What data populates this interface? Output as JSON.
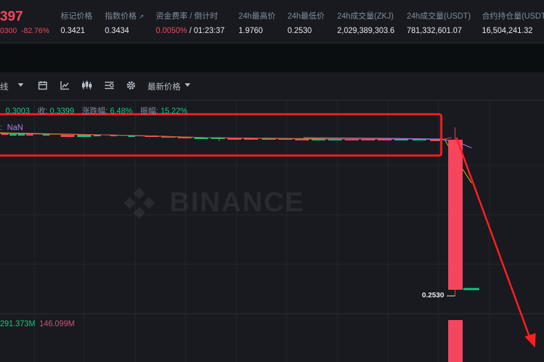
{
  "header": {
    "last_price": "397",
    "price_change": "0300",
    "price_change_pct": "-82.76%",
    "mark_price_label": "标记价格",
    "mark_price": "0.3421",
    "index_price_label": "指数价格",
    "index_price_icon": "external-link-icon",
    "index_price": "0.3434",
    "funding_label": "资金费率 / 倒计时",
    "funding_rate": "0.0050%",
    "funding_sep": " / ",
    "funding_countdown": "01:23:37",
    "high_label": "24h最高价",
    "high": "1.9760",
    "low_label": "24h最低价",
    "low": "0.2530",
    "vol_base_label": "24h成交量(ZKJ)",
    "vol_base": "2,029,389,303.6",
    "vol_quote_label": "24h成交量(USDT)",
    "vol_quote": "781,332,601.07",
    "oi_label": "合约持仓量(USDT",
    "oi": "16,504,241.32"
  },
  "toolbar": {
    "interval_label": "线",
    "price_type_label": "最新价格",
    "icons": [
      "chevron-down-icon",
      "calendar-icon",
      "indicator-icon",
      "candle-type-icon",
      "drawing-tools-icon",
      "settings-icon",
      "chevron-down-icon"
    ]
  },
  "ohlc": {
    "low_value": "0.3003",
    "close_label": "收:",
    "close_value": "0.3399",
    "change_label": "涨跌幅:",
    "change_value": "6.48%",
    "amp_label": "振幅:",
    "amp_value": "15.22%"
  },
  "ma": {
    "label": ":",
    "value": "NaN"
  },
  "watermark": "BINANCE",
  "low_marker": "0.2530",
  "volume": {
    "v1": "291.373M",
    "v2": "146.099M"
  },
  "colors": {
    "up": "#0ecb81",
    "down": "#f6465d",
    "highlight": "#ff2a2a",
    "bg": "#181a20"
  }
}
